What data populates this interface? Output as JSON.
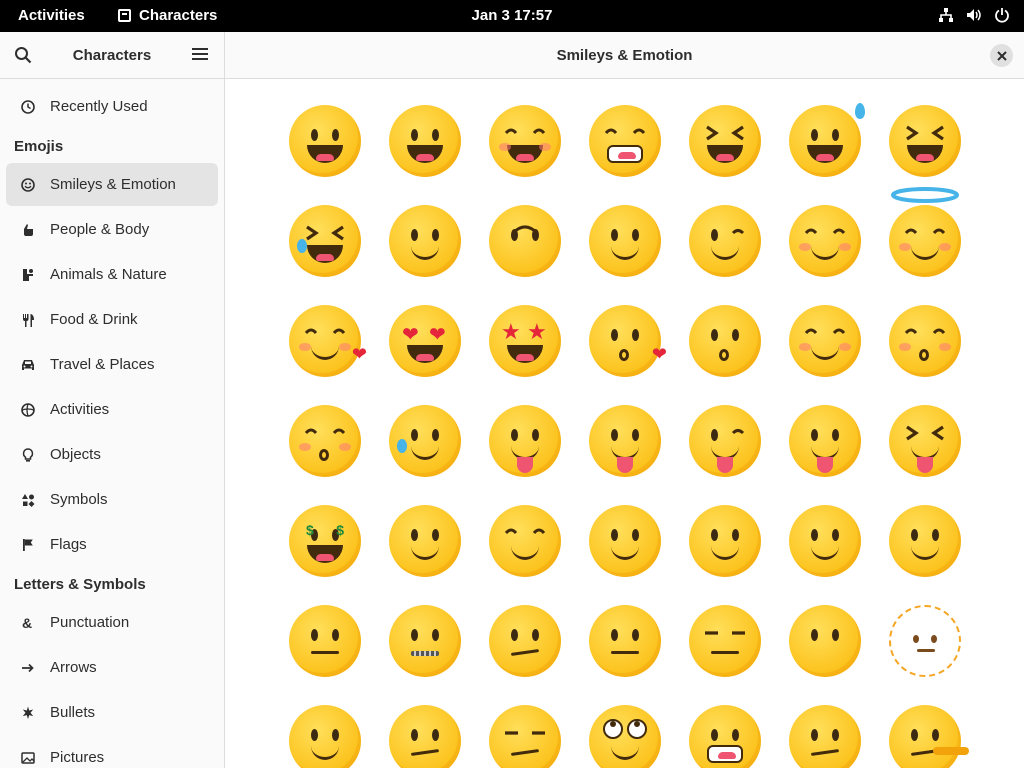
{
  "topbar": {
    "activities": "Activities",
    "app_name": "Characters",
    "clock": "Jan 3  17:57",
    "status_icons": [
      "network-icon",
      "volume-icon",
      "power-icon"
    ]
  },
  "sidebar": {
    "title": "Characters",
    "items": [
      {
        "label": "Recently Used",
        "icon": "clock-icon",
        "type": "item"
      },
      {
        "label": "Emojis",
        "type": "section"
      },
      {
        "label": "Smileys & Emotion",
        "icon": "smiley-icon",
        "type": "item",
        "active": true
      },
      {
        "label": "People & Body",
        "icon": "hand-icon",
        "type": "item"
      },
      {
        "label": "Animals & Nature",
        "icon": "animal-icon",
        "type": "item"
      },
      {
        "label": "Food & Drink",
        "icon": "food-icon",
        "type": "item"
      },
      {
        "label": "Travel & Places",
        "icon": "car-icon",
        "type": "item"
      },
      {
        "label": "Activities",
        "icon": "activities-icon",
        "type": "item"
      },
      {
        "label": "Objects",
        "icon": "lightbulb-icon",
        "type": "item"
      },
      {
        "label": "Symbols",
        "icon": "symbols-icon",
        "type": "item"
      },
      {
        "label": "Flags",
        "icon": "flag-icon",
        "type": "item"
      },
      {
        "label": "Letters & Symbols",
        "type": "section"
      },
      {
        "label": "Punctuation",
        "icon": "ampersand-icon",
        "type": "item"
      },
      {
        "label": "Arrows",
        "icon": "arrow-icon",
        "type": "item"
      },
      {
        "label": "Bullets",
        "icon": "bullet-icon",
        "type": "item"
      },
      {
        "label": "Pictures",
        "icon": "picture-icon",
        "type": "item"
      }
    ]
  },
  "main": {
    "title": "Smileys & Emotion",
    "emojis": [
      [
        "grinning-face",
        "grinning-face-big-eyes",
        "grinning-face-smiling-eyes",
        "beaming-face",
        "grinning-squinting-face",
        "grinning-face-sweat",
        "rolling-on-floor-laughing"
      ],
      [
        "face-tears-of-joy",
        "slightly-smiling-face",
        "upside-down-face",
        "melting-face",
        "winking-face",
        "smiling-face-smiling-eyes",
        "smiling-face-halo"
      ],
      [
        "smiling-face-hearts",
        "smiling-face-heart-eyes",
        "star-struck",
        "face-blowing-kiss",
        "kissing-face",
        "smiling-face",
        "kissing-face-closed-eyes"
      ],
      [
        "kissing-face-smiling-eyes",
        "smiling-face-tear",
        "face-savoring-food",
        "face-with-tongue",
        "winking-face-tongue",
        "zany-face",
        "squinting-face-tongue"
      ],
      [
        "money-mouth-face",
        "smiling-face-open-hands",
        "face-hand-over-mouth",
        "face-open-eyes-hand-over-mouth",
        "face-peeking-eye",
        "shushing-face",
        "thinking-face"
      ],
      [
        "saluting-face",
        "zipper-mouth-face",
        "face-raised-eyebrow",
        "neutral-face",
        "expressionless-face",
        "face-without-mouth",
        "dotted-line-face"
      ],
      [
        "face-in-clouds",
        "smirking-face",
        "unamused-face",
        "face-rolling-eyes",
        "grimacing-face",
        "face-exhaling",
        "lying-face"
      ]
    ]
  }
}
